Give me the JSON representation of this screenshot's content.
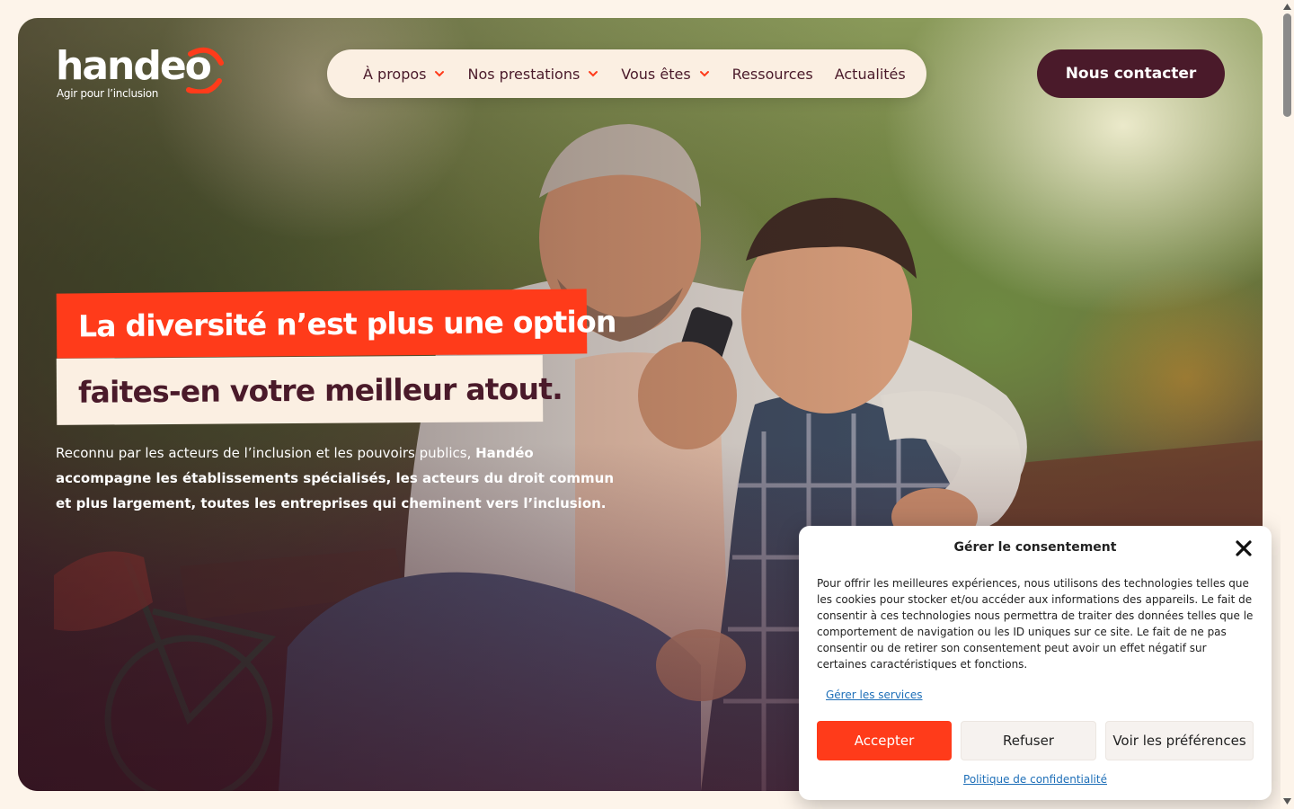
{
  "logo": {
    "wordmark": "handeo",
    "tagline": "Agir pour l’inclusion"
  },
  "nav": {
    "items": [
      {
        "label": "À propos",
        "has_dropdown": true
      },
      {
        "label": "Nos prestations",
        "has_dropdown": true
      },
      {
        "label": "Vous êtes",
        "has_dropdown": true
      },
      {
        "label": "Ressources",
        "has_dropdown": false
      },
      {
        "label": "Actualités",
        "has_dropdown": false
      }
    ],
    "cta": "Nous contacter"
  },
  "hero": {
    "headline_line1": "La diversité n’est plus une option",
    "headline_line2": "faites-en votre meilleur atout.",
    "intro_plain": "Reconnu par les acteurs de l’inclusion et les pouvoirs publics, ",
    "intro_bold": "Handéo accompagne les établissements spécialisés, les acteurs du droit commun et plus largement, toutes les entreprises qui cheminent vers l’inclusion.",
    "image_icon": "hero-photo"
  },
  "consent": {
    "title": "Gérer le consentement",
    "body": "Pour offrir les meilleures expériences, nous utilisons des technologies telles que les cookies pour stocker et/ou accéder aux informations des appareils. Le fait de consentir à ces technologies nous permettra de traiter des données telles que le comportement de navigation ou les ID uniques sur ce site. Le fait de ne pas consentir ou de retirer son consentement peut avoir un effet négatif sur certaines caractéristiques et fonctions.",
    "manage_link": "Gérer les services",
    "accept": "Accepter",
    "refuse": "Refuser",
    "preferences": "Voir les préférences",
    "policy_link": "Politique de confidentialité"
  },
  "colors": {
    "brand_red": "#ff3b1a",
    "brand_plum": "#4a1a2a",
    "cream": "#fbefe2",
    "link_blue": "#1e6fb8"
  }
}
